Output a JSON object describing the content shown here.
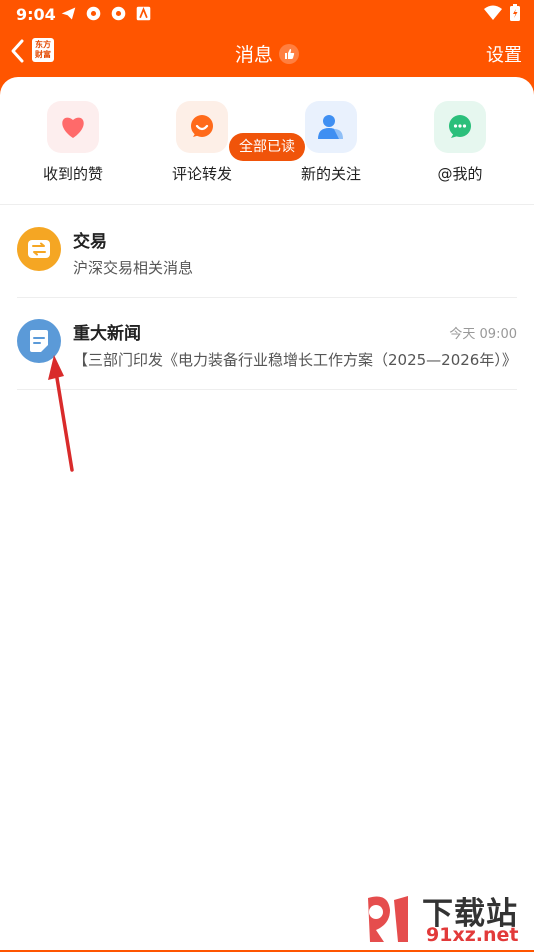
{
  "status": {
    "time": "9:04"
  },
  "header": {
    "title": "消息",
    "settings": "设置",
    "logo_text": "东方财富"
  },
  "quick_actions": [
    {
      "label": "收到的赞",
      "icon": "heart-icon",
      "color": "#ff6a6a"
    },
    {
      "label": "评论转发",
      "icon": "comment-icon",
      "color": "#ff6a1a"
    },
    {
      "label": "新的关注",
      "icon": "user-icon",
      "color": "#3f8ff2"
    },
    {
      "label": "@我的",
      "icon": "chat-icon",
      "color": "#2bbf7b"
    }
  ],
  "mark_all_read": "全部已读",
  "messages": [
    {
      "title": "交易",
      "subtitle": "沪深交易相关消息",
      "time": "",
      "icon": "exchange-icon",
      "color": "#f5a623"
    },
    {
      "title": "重大新闻",
      "subtitle": "【三部门印发《电力装备行业稳增长工作方案（2025—2026年）》",
      "time": "今天 09:00",
      "icon": "document-icon",
      "color": "#5b9ad8"
    }
  ],
  "watermark": {
    "main": "下载站",
    "domain": "91xz.net"
  }
}
